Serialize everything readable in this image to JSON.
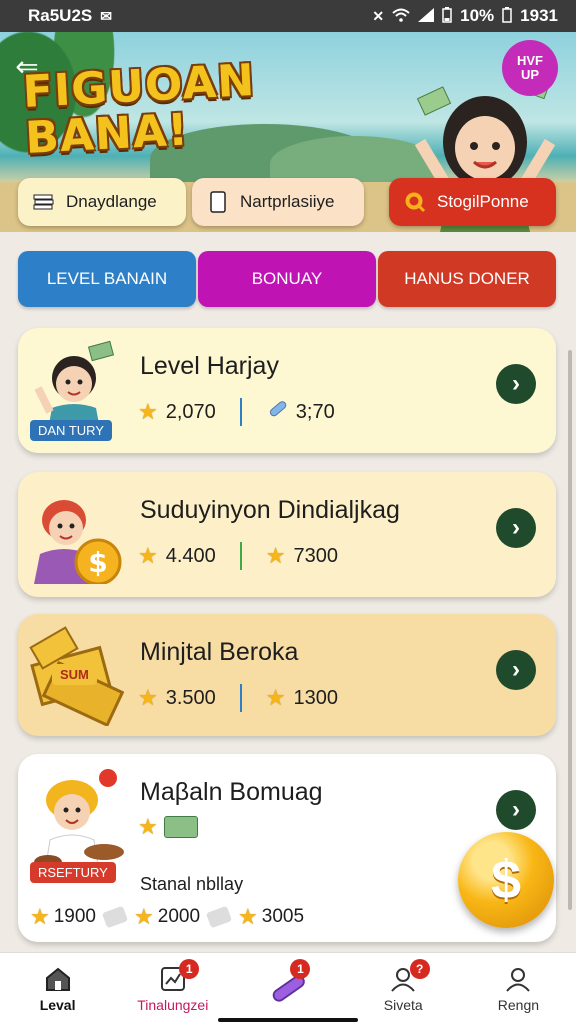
{
  "status_bar": {
    "carrier": "Ra5U2S",
    "battery": "10%",
    "time": "1931"
  },
  "hero": {
    "title_line1": "FIGUOAN",
    "title_line2": "BANA!",
    "badge": "HVF UP",
    "chips": [
      {
        "label": "Dnaydlange",
        "icon": "stack-icon"
      },
      {
        "label": "Nartprlasiiye",
        "icon": "phone-icon"
      },
      {
        "label": "StogilPonne",
        "icon": "search-icon"
      }
    ]
  },
  "tabs": [
    {
      "label": "LEVEL BANAIN",
      "color": "#2d7fc8"
    },
    {
      "label": "BONUAY",
      "color": "#c013b4"
    },
    {
      "label": "HANUS DONER",
      "color": "#d03a25"
    }
  ],
  "cards": [
    {
      "title": "Level Harjay",
      "tag": "DAN TURY",
      "stat1": "2,070",
      "stat2": "3;70"
    },
    {
      "title": "Suduyinyon Dindialjkag",
      "stat1": "4.400",
      "stat2": "7300"
    },
    {
      "title": "Minjtal Beroka",
      "tag": "SUM",
      "stat1": "3.500",
      "stat2": "1300"
    },
    {
      "title": "Maβaln Bomuag",
      "tag": "RSEFTURY",
      "subtitle": "Stanal nbllay",
      "v1": "1900",
      "v2": "2000",
      "v3": "3005"
    }
  ],
  "coin_symbol": "$",
  "bottom_nav": [
    {
      "label": "Leval",
      "badge": ""
    },
    {
      "label": "Tinalungzei",
      "badge": "1"
    },
    {
      "label": "",
      "badge": "1"
    },
    {
      "label": "Siveta",
      "badge": "?"
    },
    {
      "label": "Rengn",
      "badge": ""
    }
  ]
}
